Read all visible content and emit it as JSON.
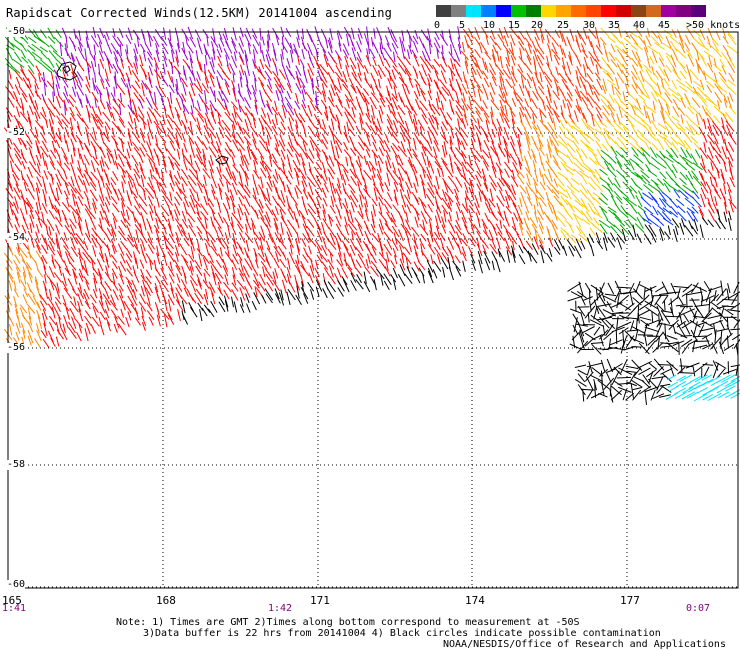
{
  "title": "Rapidscat Corrected Winds(12.5KM) 20141004 ascending",
  "colorbar": {
    "labels": [
      "0",
      "5",
      "10",
      "15",
      "20",
      "25",
      "30",
      "35",
      "40",
      "45",
      ">50 knots"
    ],
    "colors": [
      "#404040",
      "#808080",
      "#00e5ff",
      "#0080ff",
      "#0000ff",
      "#00c000",
      "#008000",
      "#ffd700",
      "#ffa500",
      "#ff6a00",
      "#ff4500",
      "#ff0000",
      "#d00000",
      "#8b4513",
      "#d2691e",
      "#a000a0",
      "#800080",
      "#5a007a"
    ]
  },
  "lat_labels": [
    "-50",
    "-52",
    "-54",
    "-56",
    "-58",
    "-60"
  ],
  "lon_labels": [
    "165",
    "168",
    "171",
    "174",
    "177"
  ],
  "time_labels": [
    "1:41",
    "1:42",
    "0:07"
  ],
  "notes": {
    "line1": "Note: 1) Times are GMT 2)Times along bottom correspond to measurement at -50S",
    "line2": "3)Data buffer is 22 hrs from 20141004 4) Black circles indicate possible contamination",
    "line3": "NOAA/NESDIS/Office of Research and Applications"
  },
  "wind_colors": {
    "purple": "#9900cc",
    "red": "#ff0000",
    "orange_red": "#ff3300",
    "orange": "#ff8800",
    "yellow": "#ffcc00",
    "green": "#00aa00",
    "blue": "#0033ff",
    "cyan": "#00e5ff",
    "black": "#000000"
  }
}
